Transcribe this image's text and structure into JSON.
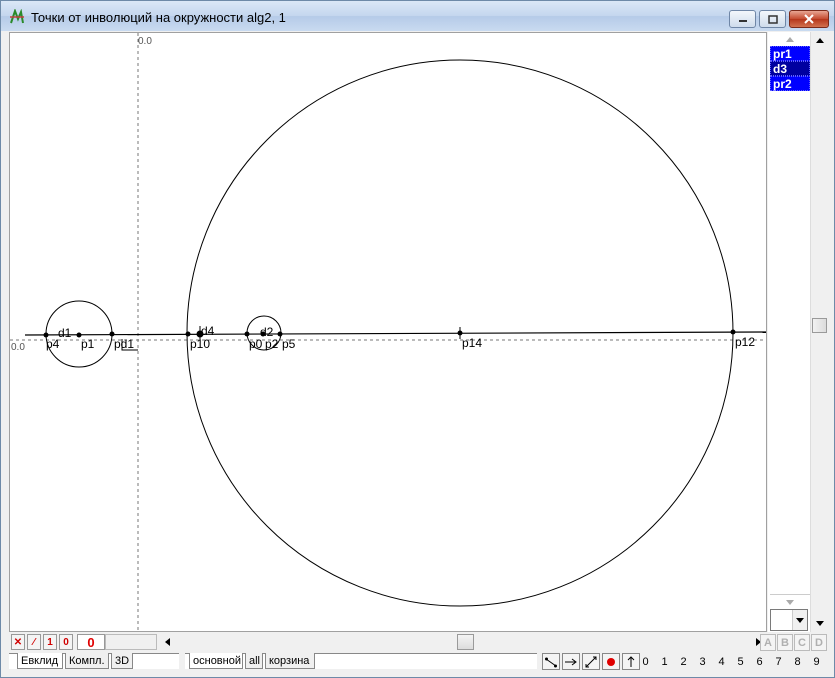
{
  "window": {
    "title": "Точки от инволюций на окружности alg2, 1"
  },
  "canvas": {
    "axis_origin_top": "0.0",
    "axis_origin_left": "0.0",
    "labels": [
      {
        "id": "d1",
        "text": "d1"
      },
      {
        "id": "p4",
        "text": "p4"
      },
      {
        "id": "p1",
        "text": "p1"
      },
      {
        "id": "pd1",
        "text": "pd1"
      },
      {
        "id": "p10",
        "text": "p10"
      },
      {
        "id": "d4",
        "text": "d4"
      },
      {
        "id": "p0",
        "text": "p0"
      },
      {
        "id": "d2",
        "text": "d2"
      },
      {
        "id": "p2",
        "text": "p2"
      },
      {
        "id": "p5",
        "text": "p5"
      },
      {
        "id": "p14",
        "text": "p14"
      },
      {
        "id": "p12",
        "text": "p12"
      }
    ]
  },
  "object_list": [
    {
      "label": "pr1",
      "color": "#0000ff"
    },
    {
      "label": "d3",
      "color": "#0000a0"
    },
    {
      "label": "pr2",
      "color": "#0000ff"
    }
  ],
  "toolbar": {
    "tool1": "✕",
    "tool2": "⁄",
    "tool3": "1",
    "tool4": "0",
    "counter": "0",
    "abcd": [
      "A",
      "B",
      "C",
      "D"
    ]
  },
  "tabs": {
    "left": [
      "Евклид",
      "Компл.",
      "3D"
    ],
    "right": [
      "основной",
      "all",
      "корзина"
    ]
  },
  "digits": [
    "0",
    "1",
    "2",
    "3",
    "4",
    "5",
    "6",
    "7",
    "8",
    "9"
  ]
}
